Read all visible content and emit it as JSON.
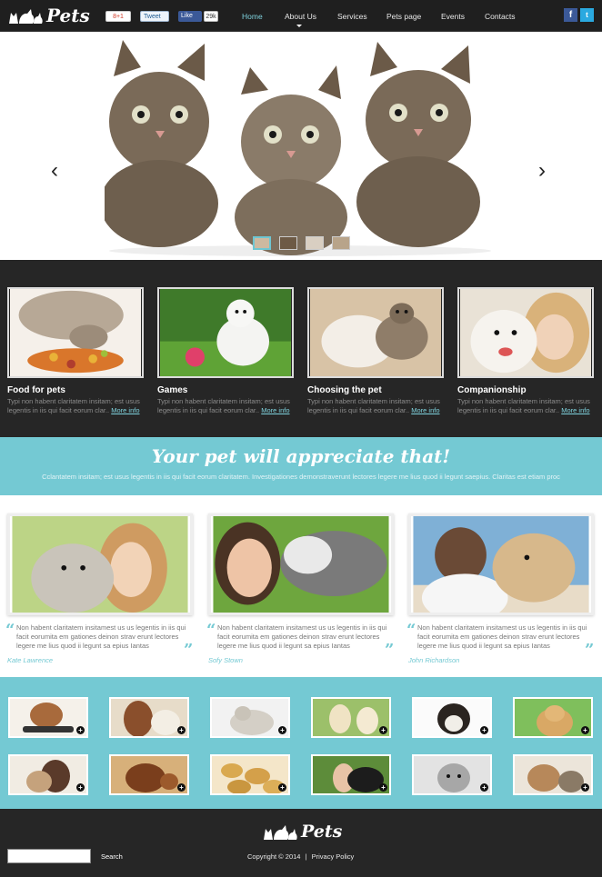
{
  "header": {
    "logo_text": "Pets",
    "social": {
      "gplus": "8+1",
      "tweet": "Tweet",
      "fb_like": "Like",
      "fb_count": "29k"
    },
    "nav": [
      "Home",
      "About Us",
      "Services",
      "Pets page",
      "Events",
      "Contacts"
    ],
    "active_nav": "Home",
    "icons": [
      "facebook-icon",
      "twitter-icon"
    ]
  },
  "hero": {
    "prev": "‹",
    "next": "›",
    "thumbnail_count": 4
  },
  "features": [
    {
      "title": "Food for pets",
      "text": "Typi non habent claritatem insitam; est usus legentis in iis qui facit eorum clar..",
      "more": "More info"
    },
    {
      "title": "Games",
      "text": "Typi non habent claritatem insitam; est usus legentis in iis qui facit eorum clar..",
      "more": "More info"
    },
    {
      "title": "Choosing the pet",
      "text": "Typi non habent claritatem insitam; est usus legentis in iis qui facit eorum clar..",
      "more": "More info"
    },
    {
      "title": "Companionship",
      "text": "Typi non habent claritatem insitam; est usus legentis in iis qui facit eorum clar..",
      "more": "More info"
    }
  ],
  "banner": {
    "heading": "Your pet will appreciate that!",
    "sub": "Cclantatem insitam; est usus legentis in iis qui facit eorum claritatem. Investigationes demonstraverunt lectores legere me lius quod ii legunt saepius. Claritas est etiam proc"
  },
  "testimonials": [
    {
      "text": "Non habent claritatem insitamest us us legentis in iis qui facit eorumita em gationes deinon strav erunt lectores legere me lius quod ii legunt sa epius Iantas",
      "name": "Kate Lawrence"
    },
    {
      "text": "Non habent claritatem insitamest us us legentis in iis qui facit eorumita em gationes deinon strav erunt lectores legere me lius quod ii legunt sa epius Iantas",
      "name": "Sofy Stown"
    },
    {
      "text": "Non habent claritatem insitamest us us legentis in iis qui facit eorumita em gationes deinon strav erunt lectores legere me lius quod ii legunt sa epius Iantas",
      "name": "John Richardson"
    }
  ],
  "gallery": {
    "plus": "+"
  },
  "footer": {
    "logo_text": "Pets",
    "search": "Search",
    "copyright": "Copyright © 2014",
    "separator": "|",
    "privacy": "Privacy Policy"
  }
}
